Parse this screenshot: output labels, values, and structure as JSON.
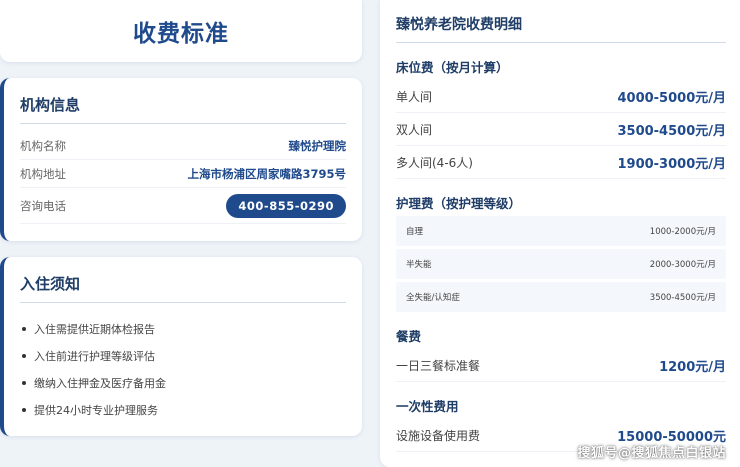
{
  "header": {
    "title": "收费标准"
  },
  "institution": {
    "title": "机构信息",
    "rows": [
      {
        "label": "机构名称",
        "value": "臻悦护理院"
      },
      {
        "label": "机构地址",
        "value": "上海市杨浦区周家嘴路3795号"
      }
    ],
    "phone_label": "咨询电话",
    "phone": "400-855-0290"
  },
  "notice": {
    "title": "入住须知",
    "items": [
      "入住需提供近期体检报告",
      "入住前进行护理等级评估",
      "缴纳入住押金及医疗备用金",
      "提供24小时专业护理服务"
    ]
  },
  "fees": {
    "title": "臻悦养老院收费明细",
    "bed": {
      "title": "床位费（按月计算）",
      "rows": [
        {
          "name": "单人间",
          "price": "4000-5000元/月"
        },
        {
          "name": "双人间",
          "price": "3500-4500元/月"
        },
        {
          "name": "多人间(4-6人)",
          "price": "1900-3000元/月"
        }
      ]
    },
    "care": {
      "title": "护理费（按护理等级）",
      "rows": [
        {
          "name": "自理",
          "price": "1000-2000元/月"
        },
        {
          "name": "半失能",
          "price": "2000-3000元/月"
        },
        {
          "name": "全失能/认知症",
          "price": "3500-4500元/月"
        }
      ]
    },
    "meal": {
      "title": "餐费",
      "rows": [
        {
          "name": "一日三餐标准餐",
          "price": "1200元/月"
        }
      ]
    },
    "onetime": {
      "title": "一次性费用",
      "rows": [
        {
          "name": "设施设备使用费",
          "price": "15000-50000元"
        }
      ]
    }
  },
  "watermark": "搜狐号@搜狐焦点白银站",
  "colors": {
    "accent": "#1f4a8c",
    "background": "#eef3f8"
  }
}
